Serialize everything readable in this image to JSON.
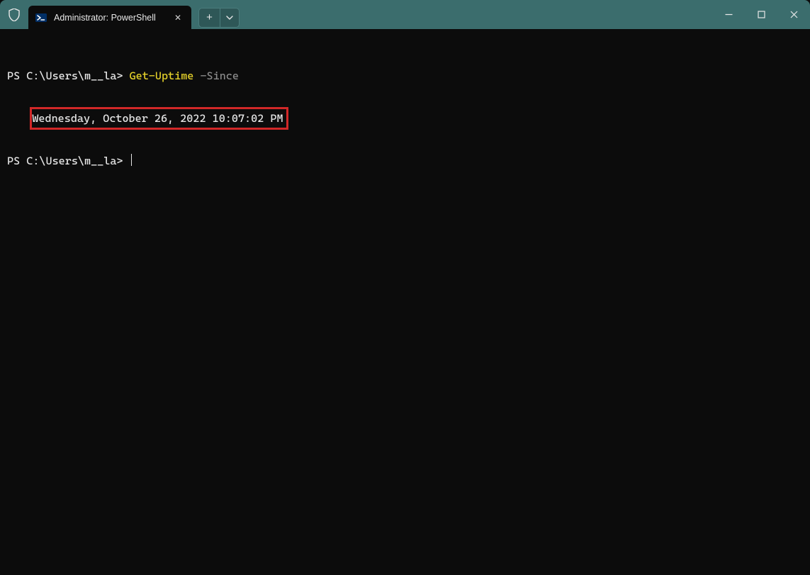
{
  "titlebar": {
    "tab_title": "Administrator: PowerShell",
    "close_glyph": "✕",
    "newtab_glyph": "+"
  },
  "terminal": {
    "prompt1_path": "PS C:\\Users\\m__la> ",
    "command_name": "Get-Uptime",
    "command_param": " -Since",
    "output_line": "Wednesday, October 26, 2022 10:07:02 PM",
    "prompt2_path": "PS C:\\Users\\m__la> "
  }
}
